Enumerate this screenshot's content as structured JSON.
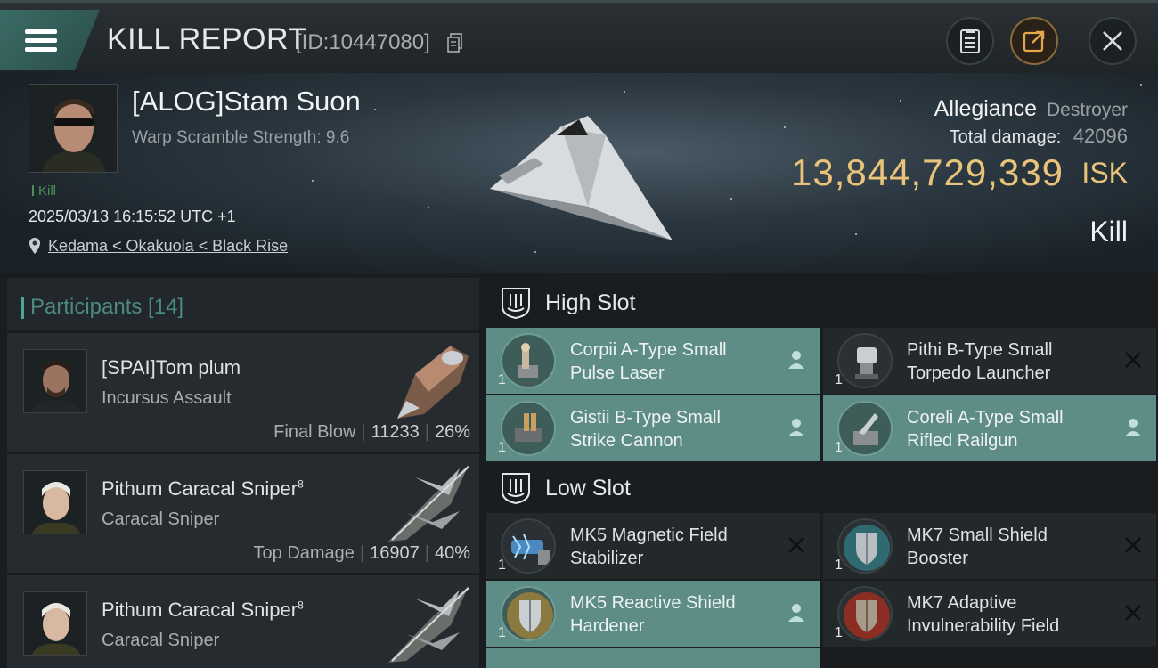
{
  "header": {
    "title": "KILL REPORT",
    "id_text": "[ID:10447080]"
  },
  "victim": {
    "name": "[ALOG]Stam Suon",
    "warp": "Warp Scramble Strength: 9.6",
    "kill_tag": "Kill",
    "datetime": "2025/03/13 16:15:52 UTC +1",
    "location": "Kedama < Okakuola < Black Rise",
    "allegiance_label": "Allegiance",
    "ship_class": "Destroyer",
    "total_damage_label": "Total damage:",
    "total_damage": "42096",
    "isk_value": "13,844,729,339",
    "isk_unit": "ISK",
    "result": "Kill"
  },
  "participants": {
    "title": "Participants [14]",
    "rows": [
      {
        "name": "[SPAI]Tom plum",
        "sup": "",
        "ship": "Incursus Assault",
        "label": "Final Blow",
        "damage": "11233",
        "percent": "26%"
      },
      {
        "name": "Pithum Caracal Sniper",
        "sup": "8",
        "ship": "Caracal Sniper",
        "label": "Top Damage",
        "damage": "16907",
        "percent": "40%"
      },
      {
        "name": "Pithum Caracal Sniper",
        "sup": "8",
        "ship": "Caracal Sniper",
        "label": "",
        "damage": "",
        "percent": ""
      }
    ]
  },
  "slots": {
    "high_label": "High Slot",
    "low_label": "Low Slot",
    "high": [
      {
        "line1": "Corpii A-Type Small",
        "line2": "Pulse Laser",
        "qty": "1",
        "status": "dropped",
        "icon": "laser-icon"
      },
      {
        "line1": "Pithi B-Type Small",
        "line2": "Torpedo Launcher",
        "qty": "1",
        "status": "destroyed",
        "icon": "launcher-icon"
      },
      {
        "line1": "Gistii B-Type Small",
        "line2": "Strike Cannon",
        "qty": "1",
        "status": "dropped",
        "icon": "cannon-icon"
      },
      {
        "line1": "Coreli A-Type Small",
        "line2": "Rifled Railgun",
        "qty": "1",
        "status": "dropped",
        "icon": "railgun-icon"
      }
    ],
    "low": [
      {
        "line1": "MK5 Magnetic Field",
        "line2": "Stabilizer",
        "qty": "1",
        "status": "destroyed",
        "icon": "stabilizer-icon"
      },
      {
        "line1": "MK7 Small Shield",
        "line2": "Booster",
        "qty": "1",
        "status": "destroyed",
        "icon": "shield-booster-icon"
      },
      {
        "line1": "MK5 Reactive Shield",
        "line2": "Hardener",
        "qty": "1",
        "status": "dropped",
        "icon": "shield-hardener-icon"
      },
      {
        "line1": "MK7 Adaptive",
        "line2": "Invulnerability Field",
        "qty": "1",
        "status": "destroyed",
        "icon": "invuln-field-icon"
      }
    ]
  },
  "colors": {
    "accent": "#5e8d87",
    "isk": "#e9c37a",
    "kill": "#4f8f5a"
  }
}
